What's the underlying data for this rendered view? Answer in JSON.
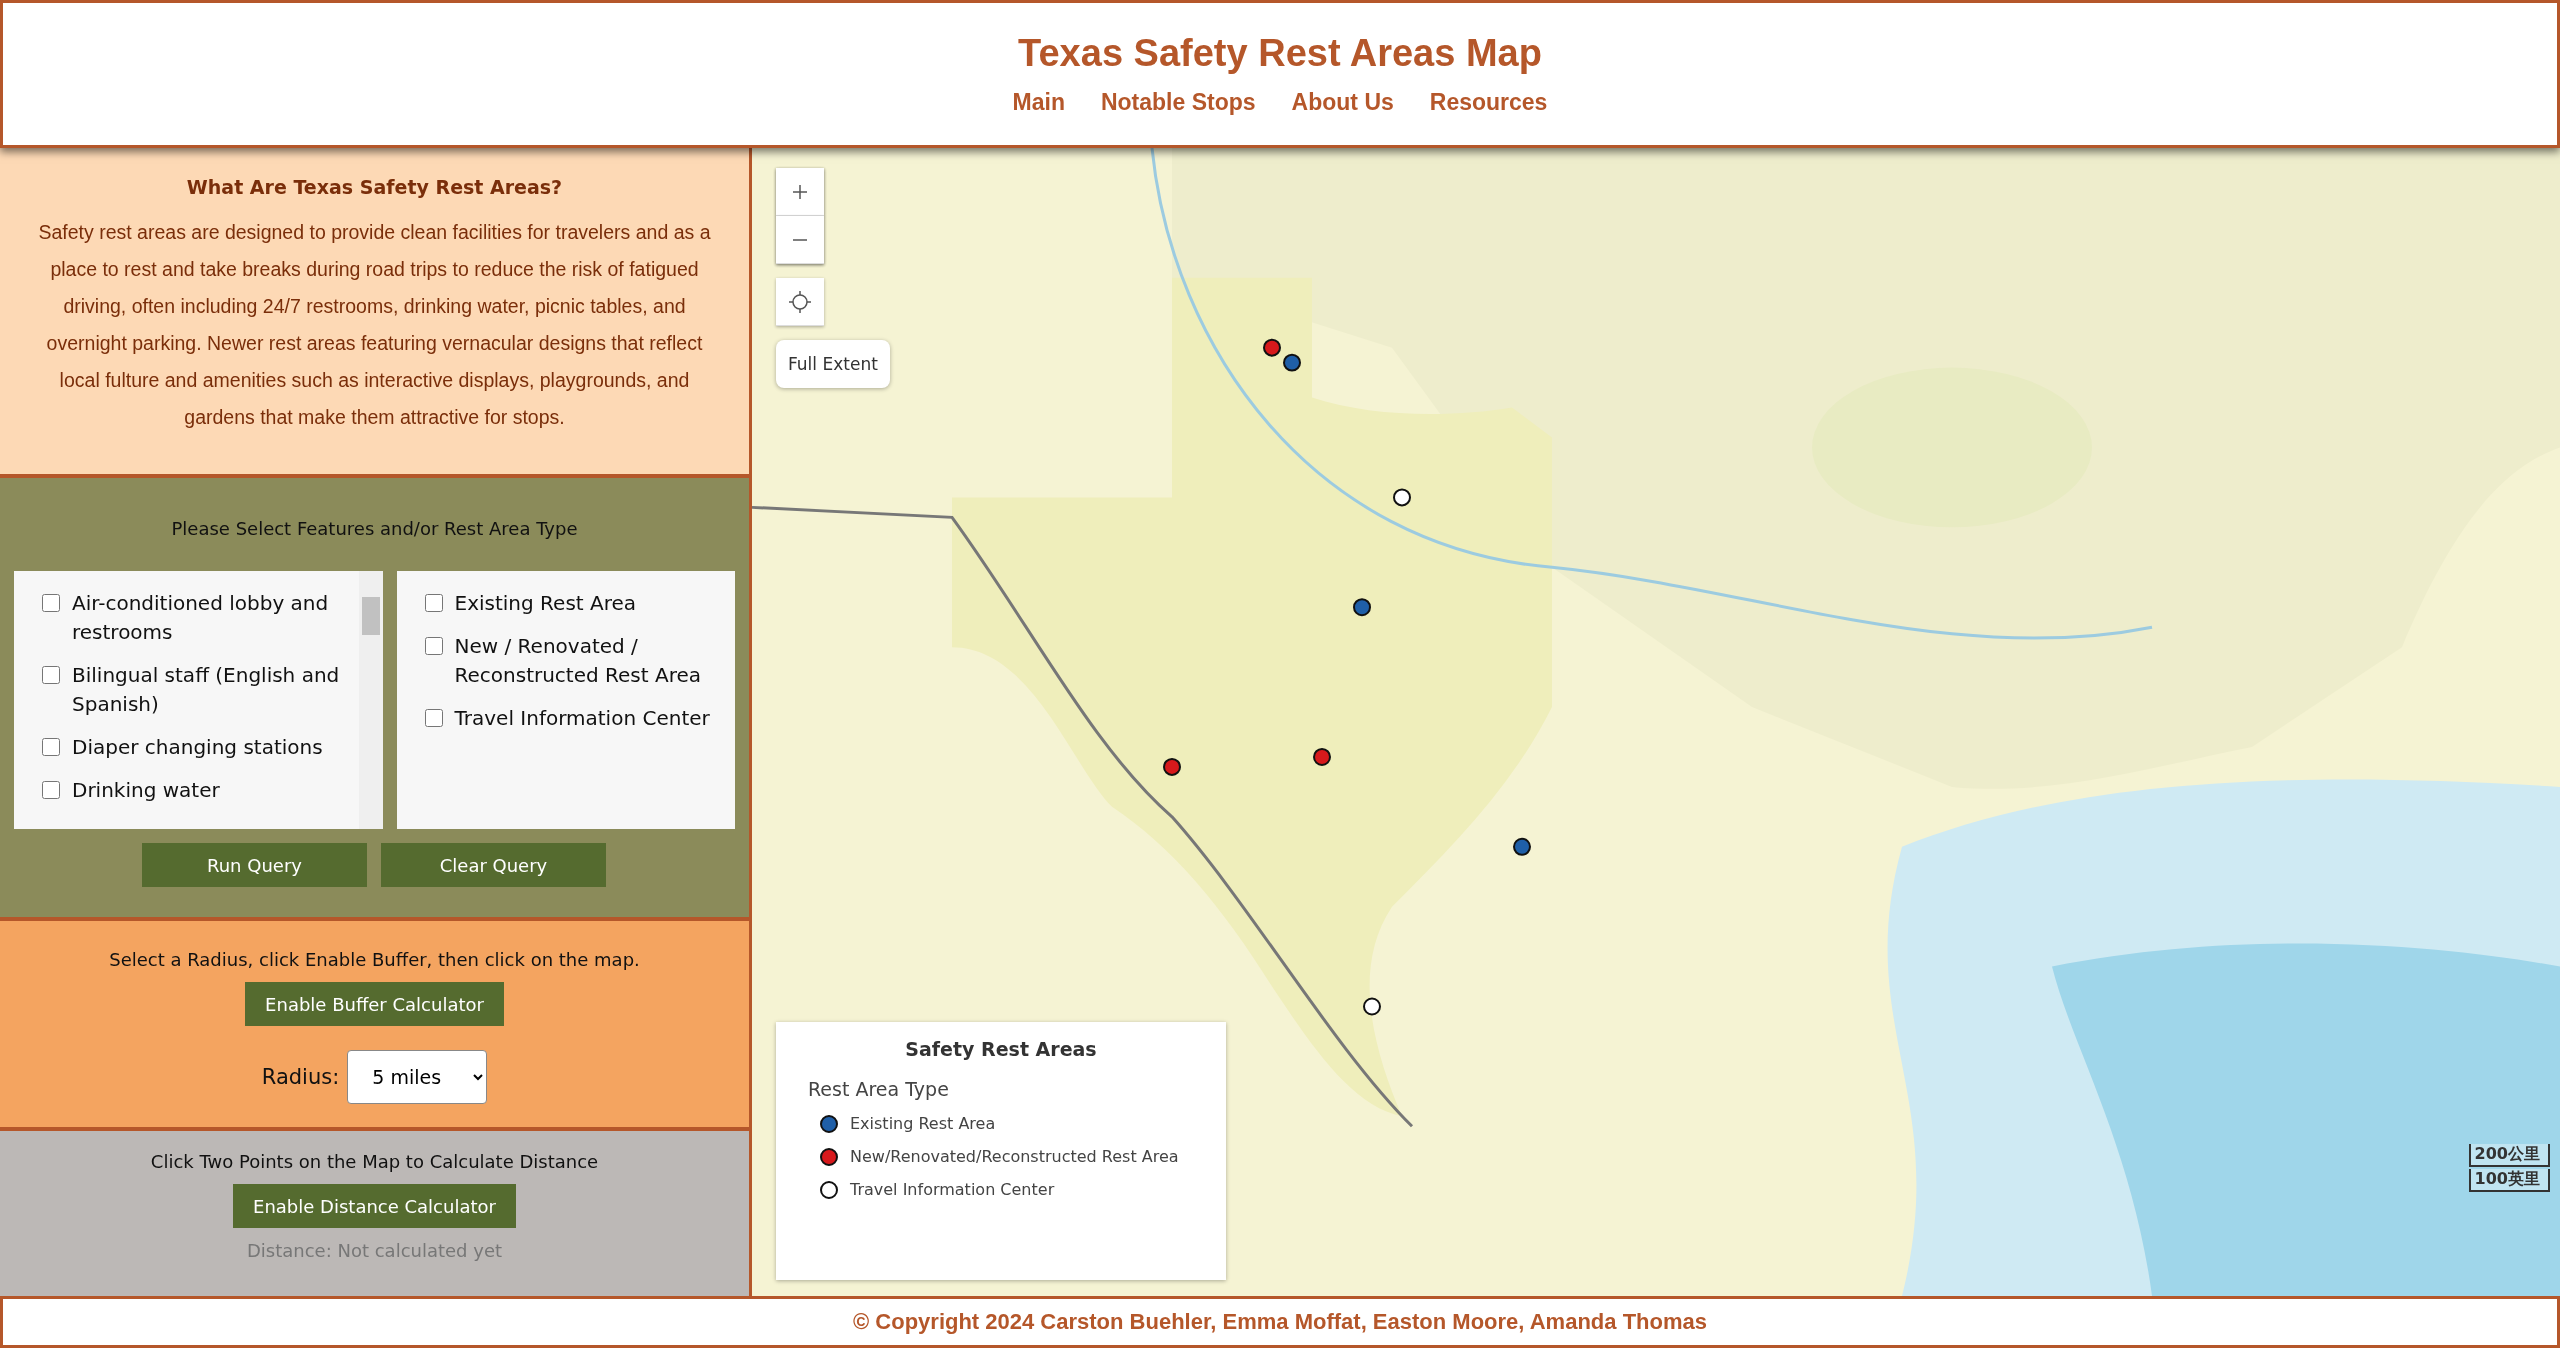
{
  "header": {
    "title": "Texas Safety Rest Areas Map",
    "nav": [
      {
        "label": "Main"
      },
      {
        "label": "Notable Stops"
      },
      {
        "label": "About Us"
      },
      {
        "label": "Resources"
      }
    ]
  },
  "intro": {
    "heading": "What Are Texas Safety Rest Areas?",
    "text": "Safety rest areas are designed to provide clean facilities for travelers and as a place to rest and take breaks during road trips to reduce the risk of fatigued driving, often including 24/7 restrooms, drinking water, picnic tables, and overnight parking. Newer rest areas featuring vernacular designs that reflect local fulture and amenities such as interactive displays, playgrounds, and gardens that make them attractive for stops."
  },
  "query": {
    "prompt": "Please Select Features and/or Rest Area Type",
    "features": [
      {
        "label": "Air-conditioned lobby and restrooms",
        "checked": false
      },
      {
        "label": "Bilingual staff (English and Spanish)",
        "checked": false
      },
      {
        "label": "Diaper changing stations",
        "checked": false
      },
      {
        "label": "Drinking water",
        "checked": false
      }
    ],
    "types": [
      {
        "label": "Existing Rest Area",
        "checked": false
      },
      {
        "label": "New / Renovated / Reconstructed Rest Area",
        "checked": false
      },
      {
        "label": "Travel Information Center",
        "checked": false
      }
    ],
    "buttons": [
      "Run Query",
      "Clear Query"
    ]
  },
  "buffer": {
    "instruction": "Select a Radius, click Enable Buffer, then click on the map.",
    "button": "Enable Buffer Calculator",
    "radius_label": "Radius:",
    "radius_value": "5 miles"
  },
  "distance": {
    "instruction": "Click Two Points on the Map to Calculate Distance",
    "button": "Enable Distance Calculator",
    "result": "Distance: Not calculated yet"
  },
  "map": {
    "kind": "picture",
    "controls": [
      {
        "kind": "zoom_in"
      },
      {
        "kind": "zoom_out"
      },
      {
        "kind": "locate"
      }
    ],
    "full_extent": "Full Extent",
    "legend": {
      "title": "Safety Rest Areas",
      "subtitle": "Rest Area Type",
      "items": [
        {
          "label": "Existing Rest Area",
          "color": "#1f5fa8"
        },
        {
          "label": "New/Renovated/Reconstructed Rest Area",
          "color": "#d7191c"
        },
        {
          "label": "Travel Information Center",
          "color": "#ffffff"
        }
      ]
    },
    "scale": [
      "200公里",
      "100英里"
    ]
  },
  "footer": "© Copyright 2024 Carston Buehler, Emma Moffat, Easton Moore, Amanda Thomas"
}
